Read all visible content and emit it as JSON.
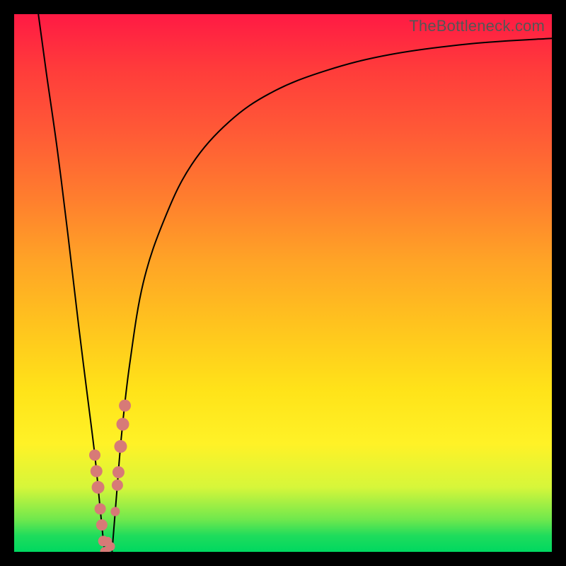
{
  "watermark": "TheBottleneck.com",
  "chart_data": {
    "type": "line",
    "title": "",
    "xlabel": "",
    "ylabel": "",
    "xlim": [
      0,
      100
    ],
    "ylim": [
      0,
      100
    ],
    "background_gradient": {
      "top_color": "#ff1a44",
      "bottom_color": "#00d860",
      "meaning": "red high = worse, green low = better"
    },
    "series": [
      {
        "name": "left-branch",
        "x": [
          4.5,
          6,
          8,
          10,
          12,
          13.5,
          15,
          16,
          16.8
        ],
        "y": [
          100,
          89,
          75,
          59,
          42,
          30,
          18,
          8,
          0
        ]
      },
      {
        "name": "right-branch",
        "x": [
          18.2,
          19,
          20,
          21.5,
          24,
          28,
          33,
          40,
          48,
          58,
          70,
          85,
          100
        ],
        "y": [
          0,
          10,
          22,
          35,
          50,
          62,
          72,
          80,
          85.5,
          89.5,
          92.5,
          94.5,
          95.5
        ]
      }
    ],
    "annotations": [
      {
        "name": "marker-cluster",
        "approx_x_range": [
          14.5,
          20.5
        ],
        "approx_y_range": [
          0,
          24
        ],
        "color": "#d77a77",
        "note": "dotted salmon markers near curve minimum"
      }
    ]
  }
}
